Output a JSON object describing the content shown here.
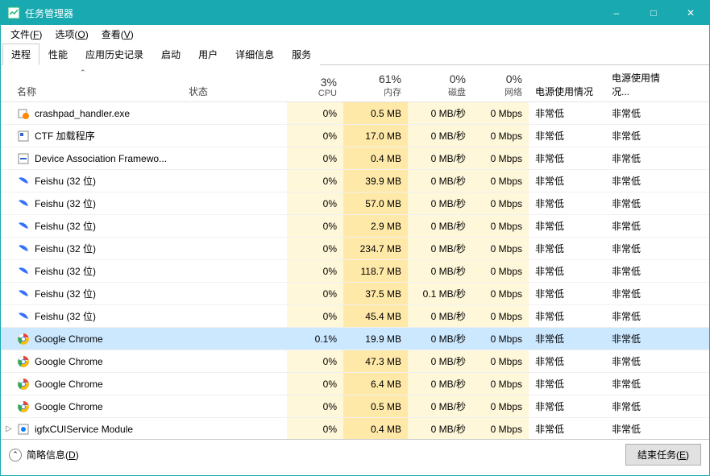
{
  "title": "任务管理器",
  "window": {
    "min": "–",
    "max": "□",
    "close": "✕"
  },
  "menu": [
    {
      "label": "文件",
      "accel": "F"
    },
    {
      "label": "选项",
      "accel": "O"
    },
    {
      "label": "查看",
      "accel": "V"
    }
  ],
  "tabs": [
    "进程",
    "性能",
    "应用历史记录",
    "启动",
    "用户",
    "详细信息",
    "服务"
  ],
  "active_tab": 0,
  "columns": {
    "name": "名称",
    "status": "状态",
    "cpu": {
      "pct": "3%",
      "label": "CPU"
    },
    "mem": {
      "pct": "61%",
      "label": "内存"
    },
    "disk": {
      "pct": "0%",
      "label": "磁盘"
    },
    "net": {
      "pct": "0%",
      "label": "网络"
    },
    "pu1": "电源使用情况",
    "pu2": "电源使用情况..."
  },
  "rows": [
    {
      "icon": "crash",
      "name": "crashpad_handler.exe",
      "cpu": "0%",
      "mem": "0.5 MB",
      "disk": "0 MB/秒",
      "net": "0 Mbps",
      "pu1": "非常低",
      "pu2": "非常低"
    },
    {
      "icon": "ctf",
      "name": "CTF 加载程序",
      "cpu": "0%",
      "mem": "17.0 MB",
      "disk": "0 MB/秒",
      "net": "0 Mbps",
      "pu1": "非常低",
      "pu2": "非常低"
    },
    {
      "icon": "daf",
      "name": "Device Association Framewo...",
      "cpu": "0%",
      "mem": "0.4 MB",
      "disk": "0 MB/秒",
      "net": "0 Mbps",
      "pu1": "非常低",
      "pu2": "非常低"
    },
    {
      "icon": "feishu",
      "name": "Feishu (32 位)",
      "cpu": "0%",
      "mem": "39.9 MB",
      "disk": "0 MB/秒",
      "net": "0 Mbps",
      "pu1": "非常低",
      "pu2": "非常低"
    },
    {
      "icon": "feishu",
      "name": "Feishu (32 位)",
      "cpu": "0%",
      "mem": "57.0 MB",
      "disk": "0 MB/秒",
      "net": "0 Mbps",
      "pu1": "非常低",
      "pu2": "非常低"
    },
    {
      "icon": "feishu",
      "name": "Feishu (32 位)",
      "cpu": "0%",
      "mem": "2.9 MB",
      "disk": "0 MB/秒",
      "net": "0 Mbps",
      "pu1": "非常低",
      "pu2": "非常低"
    },
    {
      "icon": "feishu",
      "name": "Feishu (32 位)",
      "cpu": "0%",
      "mem": "234.7 MB",
      "disk": "0 MB/秒",
      "net": "0 Mbps",
      "pu1": "非常低",
      "pu2": "非常低"
    },
    {
      "icon": "feishu",
      "name": "Feishu (32 位)",
      "cpu": "0%",
      "mem": "118.7 MB",
      "disk": "0 MB/秒",
      "net": "0 Mbps",
      "pu1": "非常低",
      "pu2": "非常低"
    },
    {
      "icon": "feishu",
      "name": "Feishu (32 位)",
      "cpu": "0%",
      "mem": "37.5 MB",
      "disk": "0.1 MB/秒",
      "net": "0 Mbps",
      "pu1": "非常低",
      "pu2": "非常低"
    },
    {
      "icon": "feishu",
      "name": "Feishu (32 位)",
      "cpu": "0%",
      "mem": "45.4 MB",
      "disk": "0 MB/秒",
      "net": "0 Mbps",
      "pu1": "非常低",
      "pu2": "非常低"
    },
    {
      "icon": "chrome",
      "name": "Google Chrome",
      "cpu": "0.1%",
      "mem": "19.9 MB",
      "disk": "0 MB/秒",
      "net": "0 Mbps",
      "pu1": "非常低",
      "pu2": "非常低",
      "selected": true
    },
    {
      "icon": "chrome",
      "name": "Google Chrome",
      "cpu": "0%",
      "mem": "47.3 MB",
      "disk": "0 MB/秒",
      "net": "0 Mbps",
      "pu1": "非常低",
      "pu2": "非常低"
    },
    {
      "icon": "chrome",
      "name": "Google Chrome",
      "cpu": "0%",
      "mem": "6.4 MB",
      "disk": "0 MB/秒",
      "net": "0 Mbps",
      "pu1": "非常低",
      "pu2": "非常低"
    },
    {
      "icon": "chrome",
      "name": "Google Chrome",
      "cpu": "0%",
      "mem": "0.5 MB",
      "disk": "0 MB/秒",
      "net": "0 Mbps",
      "pu1": "非常低",
      "pu2": "非常低"
    },
    {
      "icon": "igfx",
      "name": "igfxCUIService Module",
      "cpu": "0%",
      "mem": "0.4 MB",
      "disk": "0 MB/秒",
      "net": "0 Mbps",
      "pu1": "非常低",
      "pu2": "非常低",
      "expandable": true
    }
  ],
  "footer": {
    "brief": "简略信息",
    "brief_accel": "D",
    "end": "结束任务",
    "end_accel": "E"
  }
}
